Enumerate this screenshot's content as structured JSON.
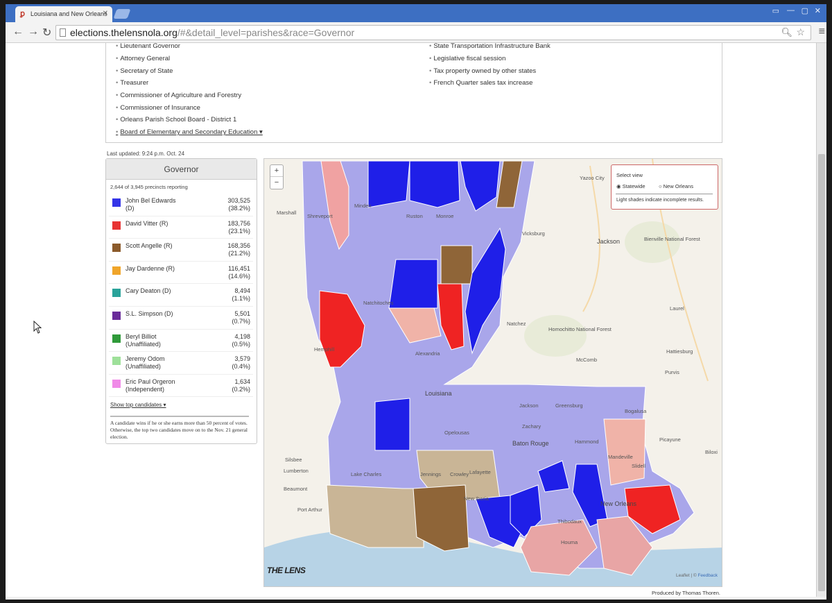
{
  "browser": {
    "tab_title": "Louisiana and New Orleans",
    "url_host": "elections.thelensnola.org",
    "url_path": "/#&detail_level=parishes&race=Governor"
  },
  "races": {
    "left": [
      "Lieutenant Governor",
      "Attorney General",
      "Secretary of State",
      "Treasurer",
      "Commissioner of Agriculture and Forestry",
      "Commissioner of Insurance",
      "Orleans Parish School Board - District 1",
      "Board of Elementary and Secondary Education ▾"
    ],
    "right": [
      "State Transportation Infrastructure Bank",
      "Legislative fiscal session",
      "Tax property owned by other states",
      "French Quarter sales tax increase"
    ]
  },
  "last_updated": "Last updated: 9:24 p.m. Oct. 24",
  "results": {
    "title": "Governor",
    "reporting": "2,644 of 3,945 precincts reporting",
    "candidates": [
      {
        "name": "John Bel Edwards",
        "party": "(D)",
        "votes": "303,525",
        "pct": "(38.2%)",
        "color": "#3434e8"
      },
      {
        "name": "David Vitter (R)",
        "party": "",
        "votes": "183,756",
        "pct": "(23.1%)",
        "color": "#e83434"
      },
      {
        "name": "Scott Angelle (R)",
        "party": "",
        "votes": "168,356",
        "pct": "(21.2%)",
        "color": "#8b5a2b"
      },
      {
        "name": "Jay Dardenne (R)",
        "party": "",
        "votes": "116,451",
        "pct": "(14.6%)",
        "color": "#f0a52a"
      },
      {
        "name": "Cary Deaton (D)",
        "party": "",
        "votes": "8,494",
        "pct": "(1.1%)",
        "color": "#2aa39a"
      },
      {
        "name": "S.L. Simpson (D)",
        "party": "",
        "votes": "5,501",
        "pct": "(0.7%)",
        "color": "#6a2c9a"
      },
      {
        "name": "Beryl Billiot",
        "party": "(Unaffiliated)",
        "votes": "4,198",
        "pct": "(0.5%)",
        "color": "#2f9a3a"
      },
      {
        "name": "Jeremy Odom",
        "party": "(Unaffiliated)",
        "votes": "3,579",
        "pct": "(0.4%)",
        "color": "#9ee09a"
      },
      {
        "name": "Eric Paul Orgeron",
        "party": "(Independent)",
        "votes": "1,634",
        "pct": "(0.2%)",
        "color": "#f08ae8"
      }
    ],
    "show_top": "Show top candidates ▾",
    "note": "A candidate wins if he or she earns more than 50 percent of votes. Otherwise, the top two candidates move on to the Nov. 21 general election."
  },
  "map": {
    "zoom_in": "+",
    "zoom_out": "−",
    "select_view_title": "Select view",
    "option_statewide": "Statewide",
    "option_new_orleans": "New Orleans",
    "hint": "Light shades indicate incomplete results.",
    "logo": "THE LENS",
    "credit_prefix": "Leaflet | ©",
    "credit_link": "Feedback",
    "labels": {
      "yazoo": "Yazoo City",
      "jackson": "Jackson",
      "marshall": "Marshall",
      "shreveport": "Shreveport",
      "minden": "Minden",
      "ruston": "Ruston",
      "monroe": "Monroe",
      "vicksburg": "Vicksburg",
      "natchitoches": "Natchitoches",
      "alexandria": "Alexandria",
      "natchez": "Natchez",
      "louisiana": "Louisiana",
      "laurel": "Laurel",
      "hattiesburg": "Hattiesburg",
      "mccomb": "McComb",
      "purvis": "Purvis",
      "homochitto": "Homochitto National Forest",
      "bienville": "Bienville National Forest",
      "hemphill": "Hemphill",
      "jackson_la": "Jackson",
      "greensburg": "Greensburg",
      "bogalusa": "Bogalusa",
      "zachary": "Zachary",
      "opelousas": "Opelousas",
      "baton_rouge": "Baton Rouge",
      "hammond": "Hammond",
      "picayune": "Picayune",
      "silsbee": "Silsbee",
      "lumberton": "Lumberton",
      "lake_charles": "Lake Charles",
      "jennings": "Jennings",
      "crowley": "Crowley",
      "lafayette": "Lafayette",
      "mandeville": "Mandeville",
      "slidell": "Slidell",
      "biloxi": "Biloxi",
      "beaumont": "Beaumont",
      "port_arthur": "Port Arthur",
      "new_iberia": "New Iberia",
      "new_orleans": "New Orleans",
      "houma": "Houma",
      "thibodaux": "Thibodaux"
    }
  },
  "produced_by": "Produced by Thomas Thoren."
}
